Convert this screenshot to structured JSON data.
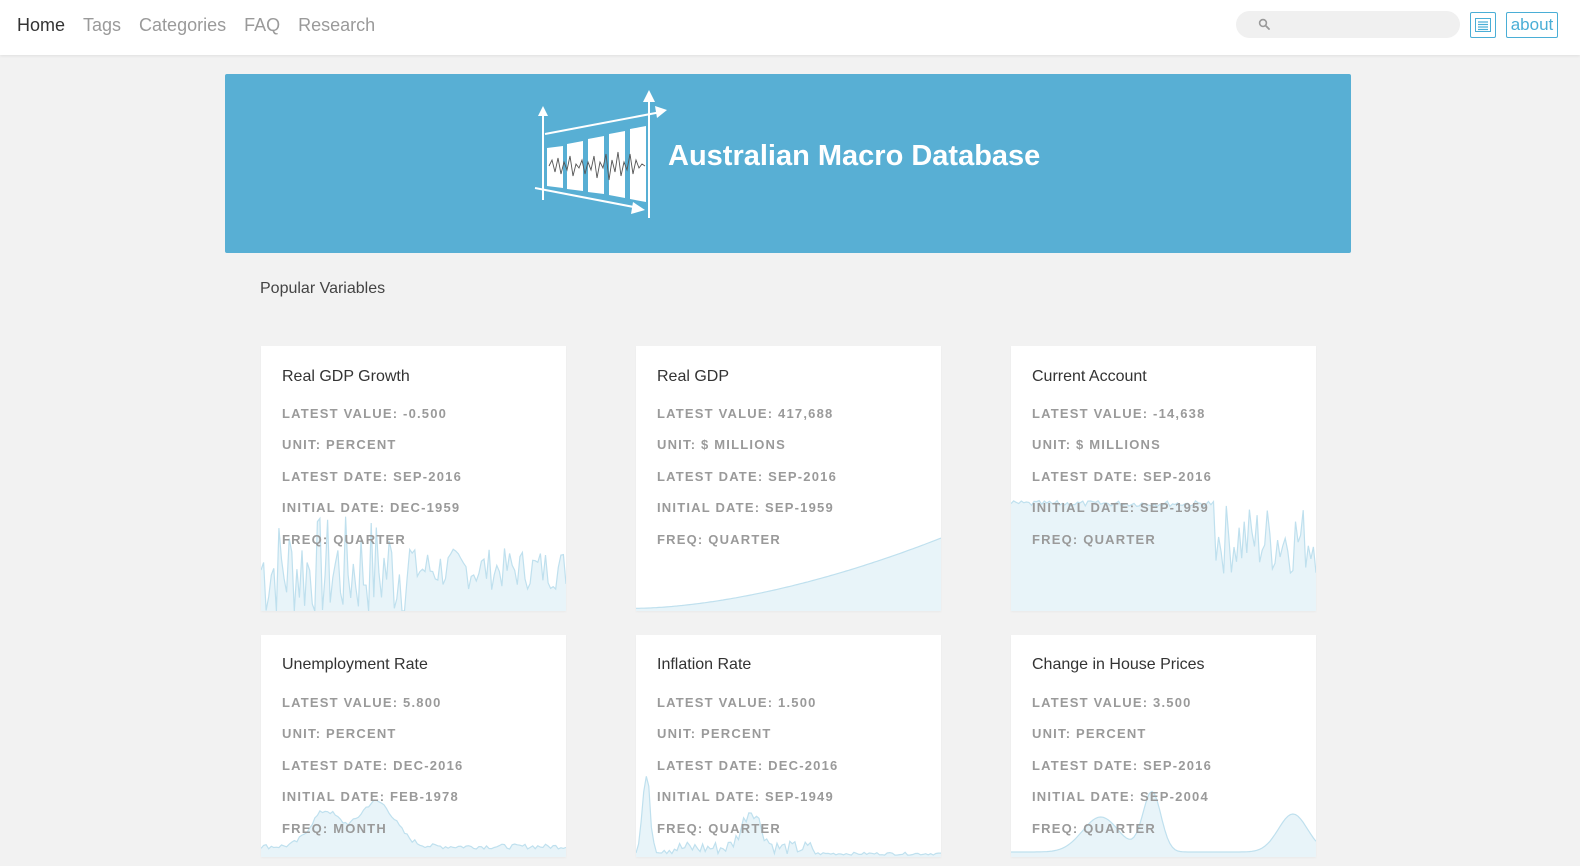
{
  "nav": {
    "links": [
      {
        "label": "Home",
        "active": true
      },
      {
        "label": "Tags",
        "active": false
      },
      {
        "label": "Categories",
        "active": false
      },
      {
        "label": "FAQ",
        "active": false
      },
      {
        "label": "Research",
        "active": false
      }
    ],
    "search": {
      "placeholder": "",
      "value": "",
      "icon": "search-icon"
    },
    "menu_icon": "list-menu-icon",
    "about_label": "about"
  },
  "banner": {
    "title": "Australian Macro Database",
    "logo_icon": "macro-chart-logo-icon"
  },
  "section_title": "Popular Variables",
  "colors": {
    "accent": "#4aaed6",
    "banner": "#58afd4",
    "spark": "#bfe0ee"
  },
  "cards": [
    {
      "title": "Real GDP Growth",
      "latest_value": "LATEST VALUE: -0.500",
      "unit": "UNIT: PERCENT",
      "latest_date": "LATEST DATE: SEP-2016",
      "initial_date": "INITIAL DATE: DEC-1959",
      "freq": "FREQ: QUARTER"
    },
    {
      "title": "Real GDP",
      "latest_value": "LATEST VALUE: 417,688",
      "unit": "UNIT: $ MILLIONS",
      "latest_date": "LATEST DATE: SEP-2016",
      "initial_date": "INITIAL DATE: SEP-1959",
      "freq": "FREQ: QUARTER"
    },
    {
      "title": "Current Account",
      "latest_value": "LATEST VALUE: -14,638",
      "unit": "UNIT: $ MILLIONS",
      "latest_date": "LATEST DATE: SEP-2016",
      "initial_date": "INITIAL DATE: SEP-1959",
      "freq": "FREQ: QUARTER"
    },
    {
      "title": "Unemployment Rate",
      "latest_value": "LATEST VALUE: 5.800",
      "unit": "UNIT: PERCENT",
      "latest_date": "LATEST DATE: DEC-2016",
      "initial_date": "INITIAL DATE: FEB-1978",
      "freq": "FREQ: MONTH"
    },
    {
      "title": "Inflation Rate",
      "latest_value": "LATEST VALUE: 1.500",
      "unit": "UNIT: PERCENT",
      "latest_date": "LATEST DATE: DEC-2016",
      "initial_date": "INITIAL DATE: SEP-1949",
      "freq": "FREQ: QUARTER"
    },
    {
      "title": "Change in House Prices",
      "latest_value": "LATEST VALUE: 3.500",
      "unit": "UNIT: PERCENT",
      "latest_date": "LATEST DATE: SEP-2016",
      "initial_date": "INITIAL DATE: SEP-2004",
      "freq": "FREQ: QUARTER"
    }
  ]
}
